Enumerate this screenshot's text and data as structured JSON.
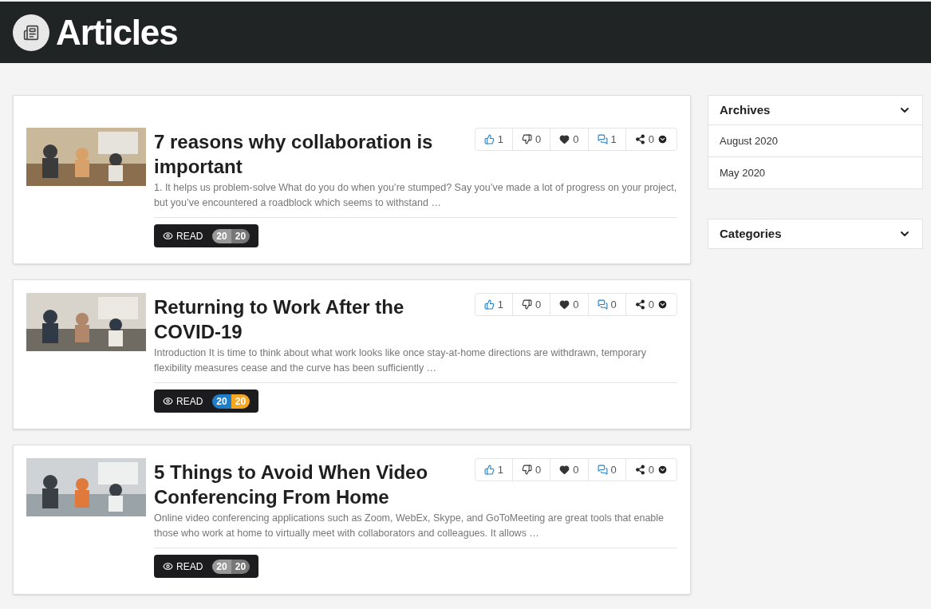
{
  "header": {
    "title": "Articles"
  },
  "articles": [
    {
      "title": "7 reasons why collaboration is important",
      "excerpt": "1. It helps us problem-solve What do you do when you’re stumped? Say you’ve made a lot of progress on your project, but you’ve encountered a roadblock which seems to withstand …",
      "reactions": {
        "likes": "1",
        "dislikes": "0",
        "loves": "0",
        "comments": "1",
        "shares": "0"
      },
      "read_label": "READ",
      "badges": [
        {
          "text": "20",
          "color": "#999999"
        },
        {
          "text": "20",
          "color": "#777777"
        }
      ]
    },
    {
      "title": "Returning to Work After the COVID-19",
      "excerpt": "Introduction It is time to think about what work looks like once stay-at-home directions are withdrawn, temporary flexibility measures cease and the curve has been sufficiently …",
      "reactions": {
        "likes": "1",
        "dislikes": "0",
        "loves": "0",
        "comments": "0",
        "shares": "0"
      },
      "read_label": "READ",
      "badges": [
        {
          "text": "20",
          "color": "#1e7fc8"
        },
        {
          "text": "20",
          "color": "#f5a623"
        }
      ]
    },
    {
      "title": "5 Things to Avoid When Video Conferencing From Home",
      "excerpt": "Online video conferencing applications such as Zoom, WebEx, Skype, and GoToMeeting are great tools that enable those who work at home to virtually meet with collaborators and colleagues. It allows …",
      "reactions": {
        "likes": "1",
        "dislikes": "0",
        "loves": "0",
        "comments": "0",
        "shares": "0"
      },
      "read_label": "READ",
      "badges": [
        {
          "text": "20",
          "color": "#999999"
        },
        {
          "text": "20",
          "color": "#777777"
        }
      ]
    }
  ],
  "sidebar": [
    {
      "title": "Archives",
      "items": [
        "August 2020",
        "May 2020"
      ]
    },
    {
      "title": "Categories"
    }
  ]
}
